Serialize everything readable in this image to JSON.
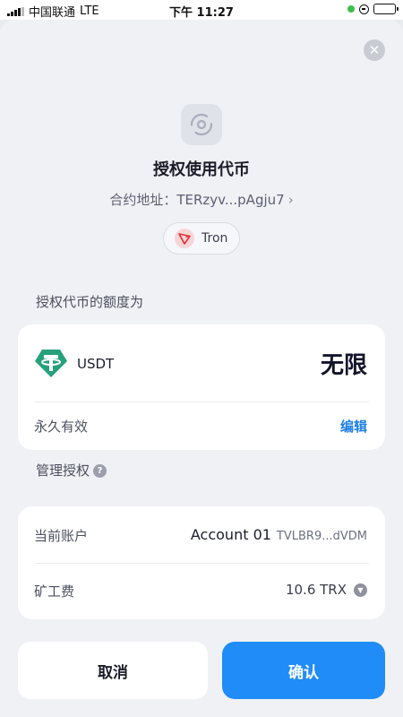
{
  "status_bar": {
    "carrier": "中国联通",
    "network": "LTE",
    "time": "下午 11:27"
  },
  "dialog": {
    "title": "授权使用代币",
    "contract_label": "合约地址：",
    "contract_address": "TERzyv...pAgju7",
    "network": "Tron",
    "close_icon": "close-icon"
  },
  "allowance": {
    "section_label": "授权代币的额度为",
    "token": "USDT",
    "amount": "无限",
    "validity": "永久有效",
    "edit_label": "编辑"
  },
  "manage": {
    "section_label": "管理授权",
    "help_glyph": "?",
    "current_account_label": "当前账户",
    "account_name": "Account 01",
    "account_address": "TVLBR9...dVDM",
    "fee_label": "矿工费",
    "fee_value": "10.6 TRX"
  },
  "actions": {
    "cancel_label": "取消",
    "confirm_label": "确认"
  },
  "colors": {
    "accent": "#1f8cf7",
    "link": "#1f7fe5",
    "usdt": "#26a17b",
    "tron": "#e0323c"
  }
}
